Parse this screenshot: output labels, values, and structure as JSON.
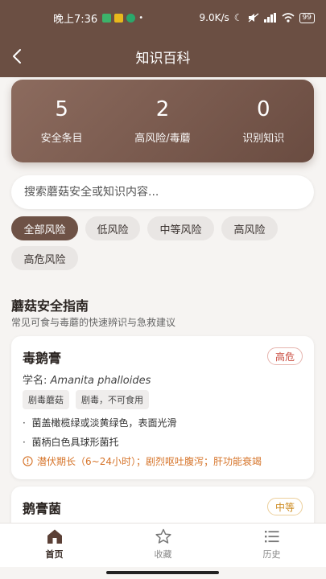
{
  "status_bar": {
    "time": "晚上7:36",
    "speed": "9.0K/s",
    "battery": "99"
  },
  "header": {
    "title": "知识百科"
  },
  "stats": [
    {
      "value": "5",
      "label": "安全条目"
    },
    {
      "value": "2",
      "label": "高风险/毒蘑"
    },
    {
      "value": "0",
      "label": "识别知识"
    }
  ],
  "search": {
    "placeholder": "搜索蘑菇安全或知识内容..."
  },
  "filters": [
    "全部风险",
    "低风险",
    "中等风险",
    "高风险",
    "高危风险"
  ],
  "section": {
    "title": "蘑菇安全指南",
    "subtitle": "常见可食与毒蘑的快速辨识与急救建议"
  },
  "cards": [
    {
      "name": "毒鹅膏",
      "badge": "高危",
      "sci_prefix": "学名: ",
      "sci_name": "Amanita phalloides",
      "tags": [
        "剧毒蘑菇",
        "剧毒，不可食用"
      ],
      "bullets": [
        "菌盖橄榄绿或淡黄绿色，表面光滑",
        "菌柄白色具球形菌托"
      ],
      "warning": "潜伏期长（6~24小时）；剧烈呕吐腹泻；肝功能衰竭"
    },
    {
      "name": "鹅膏菌",
      "badge": "中等"
    }
  ],
  "tabs": [
    {
      "label": "首页",
      "icon": "home-icon"
    },
    {
      "label": "收藏",
      "icon": "star-icon"
    },
    {
      "label": "历史",
      "icon": "list-icon"
    }
  ],
  "colors": {
    "brand": "#6b4f43",
    "danger": "#c8483c",
    "medium": "#cc8a1f",
    "warning": "#d6742a"
  }
}
